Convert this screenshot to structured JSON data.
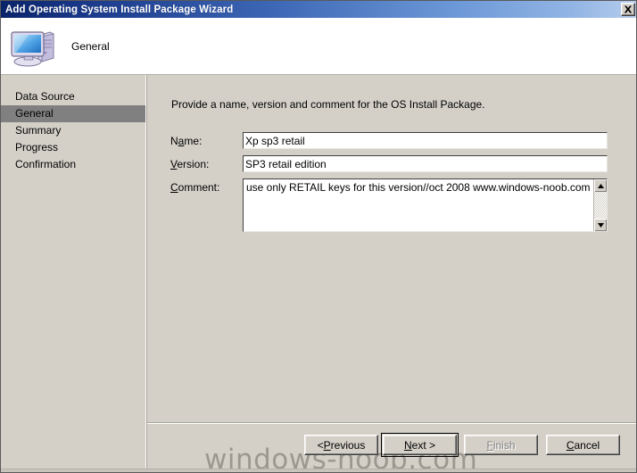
{
  "window": {
    "title": "Add Operating System Install Package Wizard",
    "close_icon": "close-x-icon"
  },
  "header": {
    "icon": "computer-monitor-icon",
    "title": "General"
  },
  "sidebar": {
    "items": [
      {
        "label": "Data Source",
        "selected": false
      },
      {
        "label": "General",
        "selected": true
      },
      {
        "label": "Summary",
        "selected": false
      },
      {
        "label": "Progress",
        "selected": false
      },
      {
        "label": "Confirmation",
        "selected": false
      }
    ]
  },
  "content": {
    "instruction": "Provide a name, version and comment for the OS Install Package.",
    "fields": {
      "name": {
        "label_prefix": "N",
        "label_accel": "a",
        "label_suffix": "me:",
        "value": "Xp sp3 retail",
        "placeholder": ""
      },
      "version": {
        "label_prefix": "",
        "label_accel": "V",
        "label_suffix": "ersion:",
        "value": "SP3 retail edition",
        "placeholder": ""
      },
      "comment": {
        "label_prefix": "",
        "label_accel": "C",
        "label_suffix": "omment:",
        "value": "use only RETAIL keys for this version//oct 2008 www.windows-noob.com",
        "placeholder": ""
      }
    },
    "scrollbar": {
      "up_icon": "scroll-up-arrow-icon",
      "down_icon": "scroll-down-arrow-icon"
    }
  },
  "footer": {
    "buttons": [
      {
        "prefix": "< ",
        "accel": "P",
        "suffix": "revious",
        "state": "enabled",
        "default": false
      },
      {
        "prefix": "",
        "accel": "N",
        "suffix": "ext >",
        "state": "enabled",
        "default": true
      },
      {
        "prefix": "",
        "accel": "F",
        "suffix": "inish",
        "state": "disabled",
        "default": false
      },
      {
        "prefix": "",
        "accel": "C",
        "suffix": "ancel",
        "state": "enabled",
        "default": false
      }
    ]
  },
  "watermark": {
    "text": "windows-noob.com"
  },
  "colors": {
    "titlebar_start": "#0a246a",
    "titlebar_end": "#b7cdec",
    "dialog_face": "#d4d0c8",
    "selected_nav": "#808080",
    "field_background": "#ffffff",
    "watermark": "#9a968c"
  }
}
